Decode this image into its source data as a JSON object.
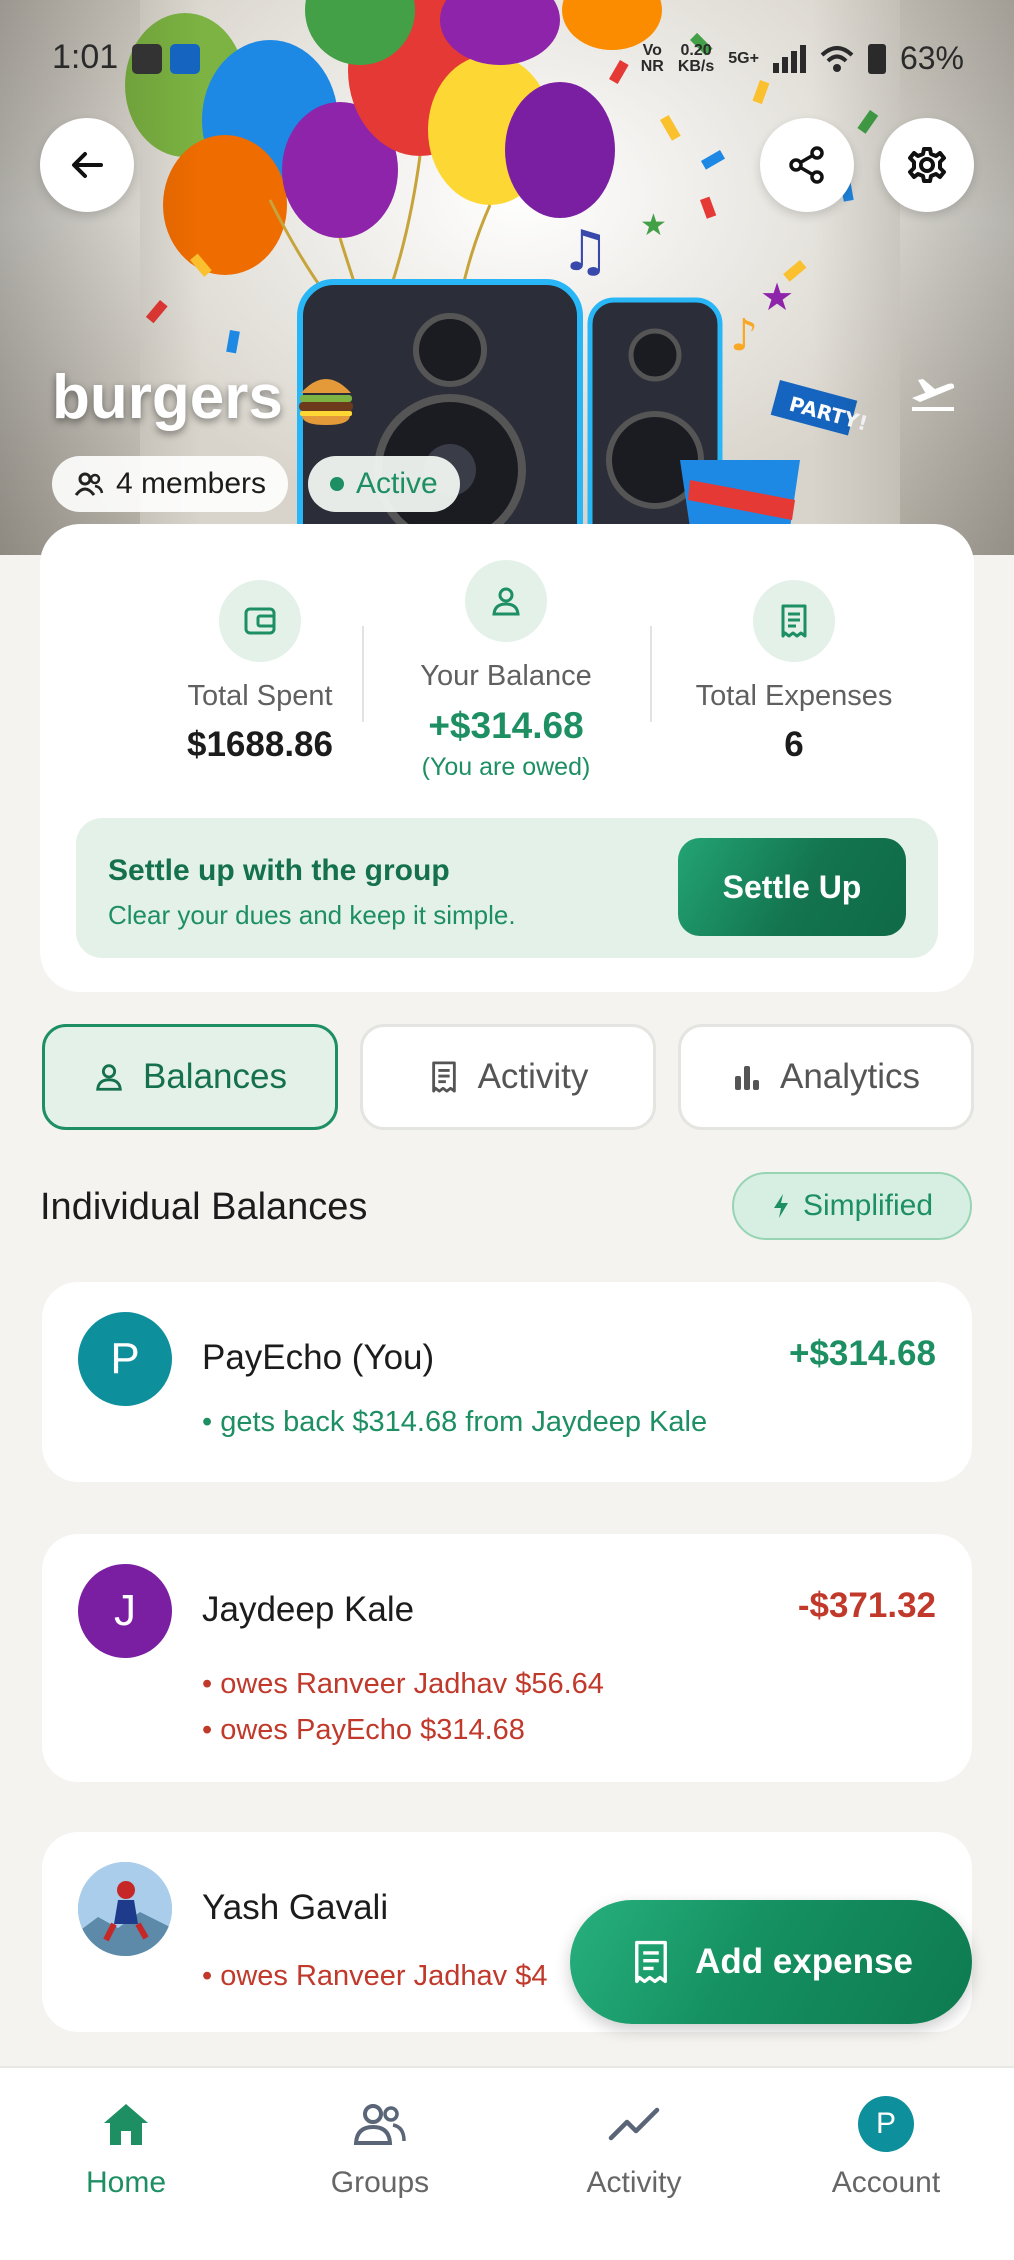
{
  "status_bar": {
    "time": "1:01",
    "network_top": "Vo",
    "network_bottom": "NR",
    "speed_top": "0.20",
    "speed_bottom": "KB/s",
    "signal": "5G+",
    "battery": "63%"
  },
  "group": {
    "name": "burgers",
    "members_label": "4 members",
    "status_label": "Active"
  },
  "summary": {
    "total_spent_label": "Total Spent",
    "total_spent_value": "$1688.86",
    "your_balance_label": "Your Balance",
    "your_balance_value": "+$314.68",
    "your_balance_sub": "(You are owed)",
    "total_expenses_label": "Total Expenses",
    "total_expenses_value": "6"
  },
  "settle": {
    "title": "Settle up with the group",
    "subtitle": "Clear your dues and keep it simple.",
    "button_label": "Settle Up"
  },
  "tabs": [
    {
      "label": "Balances",
      "active": true
    },
    {
      "label": "Activity",
      "active": false
    },
    {
      "label": "Analytics",
      "active": false
    }
  ],
  "balances_section": {
    "title": "Individual Balances",
    "badge": "Simplified"
  },
  "members": [
    {
      "initial": "P",
      "name": "PayEcho (You)",
      "amount": "+$314.68",
      "lines": [
        "gets back $314.68 from Jaydeep Kale"
      ],
      "color": "#0e8f9c"
    },
    {
      "initial": "J",
      "name": "Jaydeep Kale",
      "amount": "-$371.32",
      "lines": [
        "owes Ranveer Jadhav $56.64",
        "owes PayEcho $314.68"
      ],
      "color": "#7a1fa2"
    },
    {
      "initial": "",
      "name": "Yash Gavali",
      "amount": "",
      "lines": [
        "owes Ranveer Jadhav $4"
      ],
      "color": "#6a8fb8"
    }
  ],
  "fab": {
    "label": "Add expense"
  },
  "bottom_nav": {
    "home": "Home",
    "groups": "Groups",
    "activity": "Activity",
    "account": "Account",
    "account_initial": "P"
  },
  "colors": {
    "accent": "#1d8f63",
    "accent_light": "#e4f1e8",
    "negative": "#c0392b",
    "background": "#f4f3ef"
  }
}
